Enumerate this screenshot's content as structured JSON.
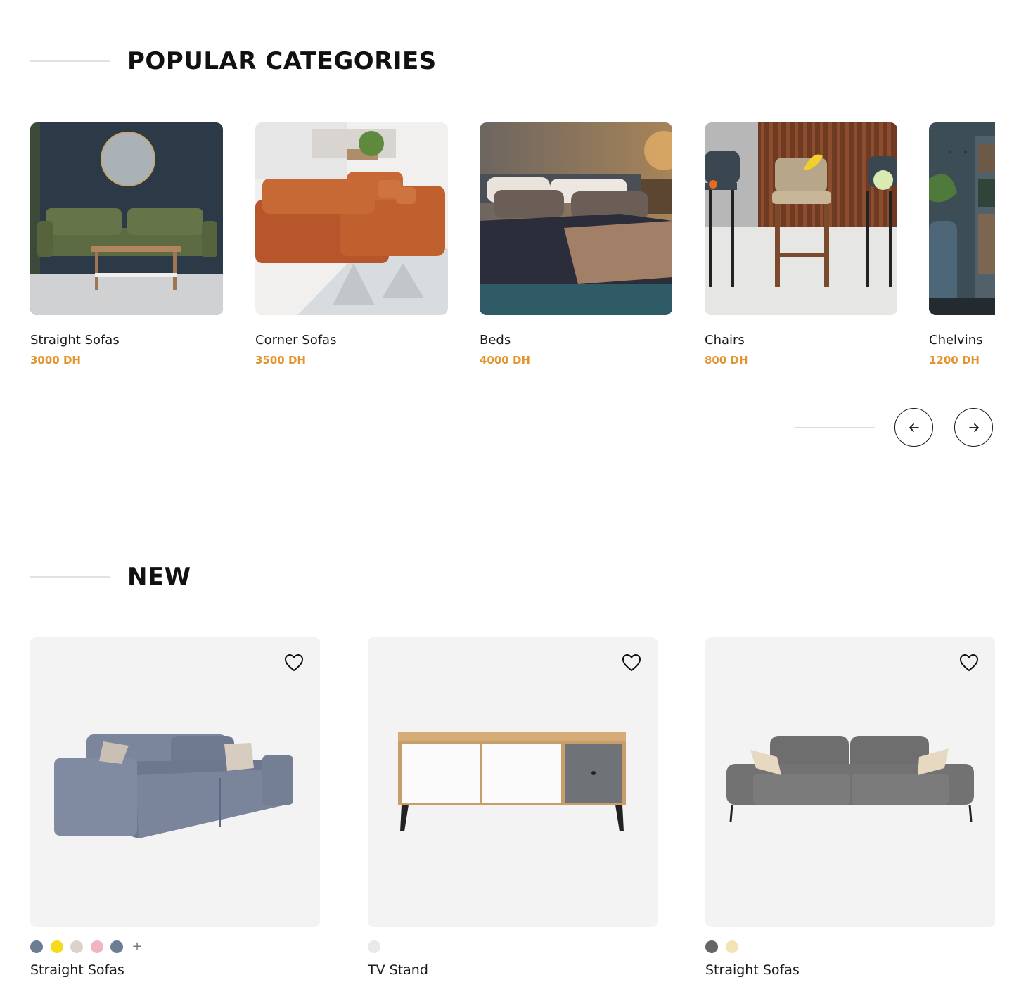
{
  "popular": {
    "title": "POPULAR CATEGORIES",
    "items": [
      {
        "name": "Straight Sofas",
        "price": "3000 DH",
        "image": "green-sofa-photo"
      },
      {
        "name": "Corner Sofas",
        "price": "3500 DH",
        "image": "orange-corner-sofa-photo"
      },
      {
        "name": "Beds",
        "price": "4000 DH",
        "image": "bed-photo"
      },
      {
        "name": "Chairs",
        "price": "800 DH",
        "image": "bar-stools-photo"
      },
      {
        "name": "Chelvins",
        "price": "1200 DH",
        "image": "shelf-photo"
      }
    ],
    "prev_icon": "arrow-left-icon",
    "next_icon": "arrow-right-icon"
  },
  "new_section": {
    "title": "NEW",
    "products": [
      {
        "name": "Straight Sofas",
        "image": "grey-blue-sofa",
        "swatches": [
          "#6b7d93",
          "#f2dc1c",
          "#ddd2ca",
          "#f2b4c0",
          "#6b7d93"
        ],
        "more": "+"
      },
      {
        "name": "TV Stand",
        "image": "tv-stand",
        "swatches": [
          "#e9e9e9"
        ],
        "more": ""
      },
      {
        "name": "Straight Sofas",
        "image": "grey-sofa",
        "swatches": [
          "#666666",
          "#f3e3b4"
        ],
        "more": ""
      }
    ],
    "wishlist_icon": "heart-icon"
  },
  "colors": {
    "price": "#e3942c",
    "text": "#1a1a1a",
    "card_bg": "#f3f3f3"
  }
}
